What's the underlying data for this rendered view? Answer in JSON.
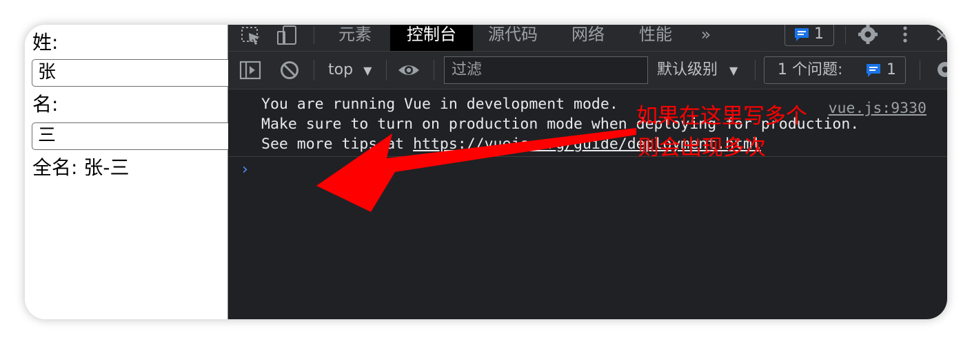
{
  "page": {
    "surname_label": "姓:",
    "surname_value": "张",
    "given_label": "名:",
    "given_value": "三",
    "fullname_text": "全名: 张-三"
  },
  "devtools": {
    "tabs": [
      {
        "label": "元素",
        "active": false
      },
      {
        "label": "控制台",
        "active": true
      },
      {
        "label": "源代码",
        "active": false
      },
      {
        "label": "网络",
        "active": false
      },
      {
        "label": "性能",
        "active": false
      }
    ],
    "more_tabs": "»",
    "message_badge_count": "1",
    "context_selector": "top",
    "filter_placeholder": "过滤",
    "log_level": "默认级别",
    "issues_label": "1 个问题:",
    "issues_count": "1",
    "console": {
      "lines": [
        "You are running Vue in development mode.",
        "Make sure to turn on production mode when deploying for production.",
        "See more tips at "
      ],
      "tips_link": "https://vuejs.org/guide/deployment.html",
      "source_link": "vue.js:9330",
      "prompt": "›"
    },
    "colors": {
      "panel_bg": "#202124",
      "toolbar_bg": "#292a2d",
      "badge_blue": "#1a73e8",
      "annotation_red": "#ff0000"
    }
  },
  "annotation": {
    "line1": "如果在这里写多个",
    "line2": "则会出现多次"
  }
}
